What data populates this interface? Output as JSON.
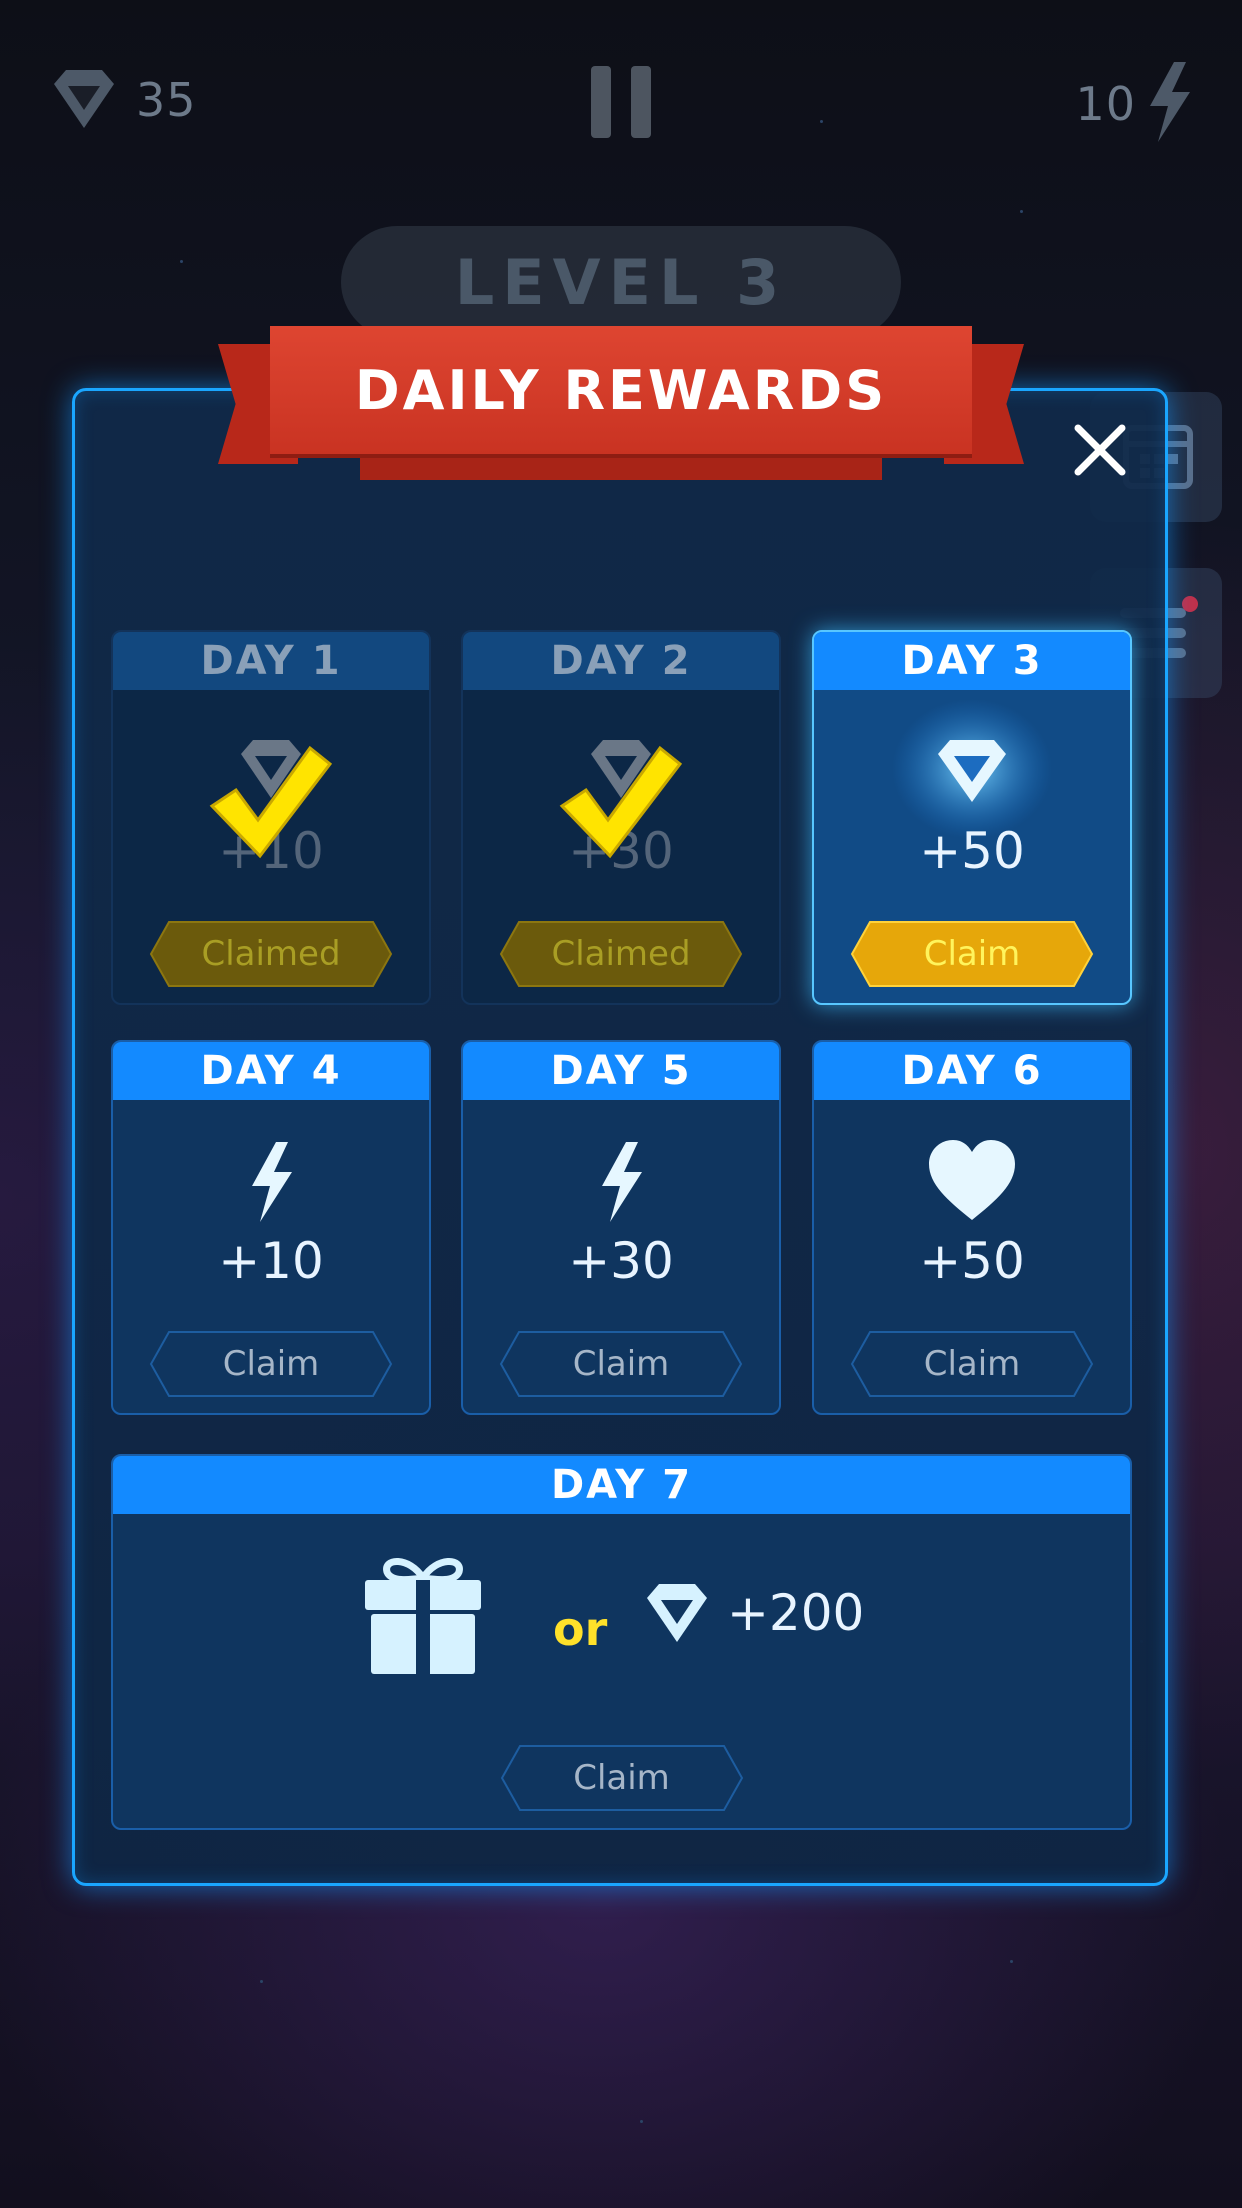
{
  "hud": {
    "gems": "35",
    "energy": "10"
  },
  "level": {
    "title": "LEVEL 3"
  },
  "dialog": {
    "title": "DAILY REWARDS",
    "days": [
      {
        "label": "DAY 1",
        "amount": "+10",
        "reward_icon": "diamond-icon",
        "button": "Claimed",
        "status": "claimed"
      },
      {
        "label": "DAY 2",
        "amount": "+30",
        "reward_icon": "diamond-icon",
        "button": "Claimed",
        "status": "claimed"
      },
      {
        "label": "DAY 3",
        "amount": "+50",
        "reward_icon": "diamond-icon",
        "button": "Claim",
        "status": "available"
      },
      {
        "label": "DAY 4",
        "amount": "+10",
        "reward_icon": "lightning-icon",
        "button": "Claim",
        "status": "locked"
      },
      {
        "label": "DAY 5",
        "amount": "+30",
        "reward_icon": "lightning-icon",
        "button": "Claim",
        "status": "locked"
      },
      {
        "label": "DAY 6",
        "amount": "+50",
        "reward_icon": "heart-icon",
        "button": "Claim",
        "status": "locked"
      }
    ],
    "day7": {
      "label": "DAY 7",
      "or_text": "or",
      "amount": "+200",
      "reward_icons": [
        "gift-icon",
        "diamond-icon"
      ],
      "button": "Claim",
      "status": "locked"
    }
  },
  "colors": {
    "panel_border": "#1aa6ff",
    "header_blue": "#138aff",
    "ribbon_red": "#d63c29",
    "gold": "#ffe12a"
  }
}
